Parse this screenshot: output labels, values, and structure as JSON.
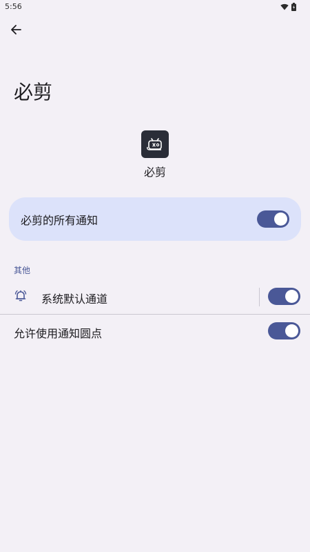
{
  "status_bar": {
    "time": "5:56",
    "icons": [
      "wifi-icon",
      "battery-icon"
    ]
  },
  "header": {
    "back_icon": "arrow-left-icon",
    "title": "必剪"
  },
  "app": {
    "name": "必剪",
    "icon": "app-icon"
  },
  "master": {
    "label": "必剪的所有通知",
    "enabled": true
  },
  "section": {
    "header": "其他"
  },
  "channels": [
    {
      "label": "系统默认通道",
      "icon": "bell-icon",
      "enabled": true
    }
  ],
  "dots": {
    "label": "允许使用通知圆点",
    "enabled": true
  },
  "colors": {
    "background": "#f3f0f6",
    "card": "#dce2fa",
    "accent": "#4a5897",
    "app_icon_bg": "#2a2d38"
  }
}
